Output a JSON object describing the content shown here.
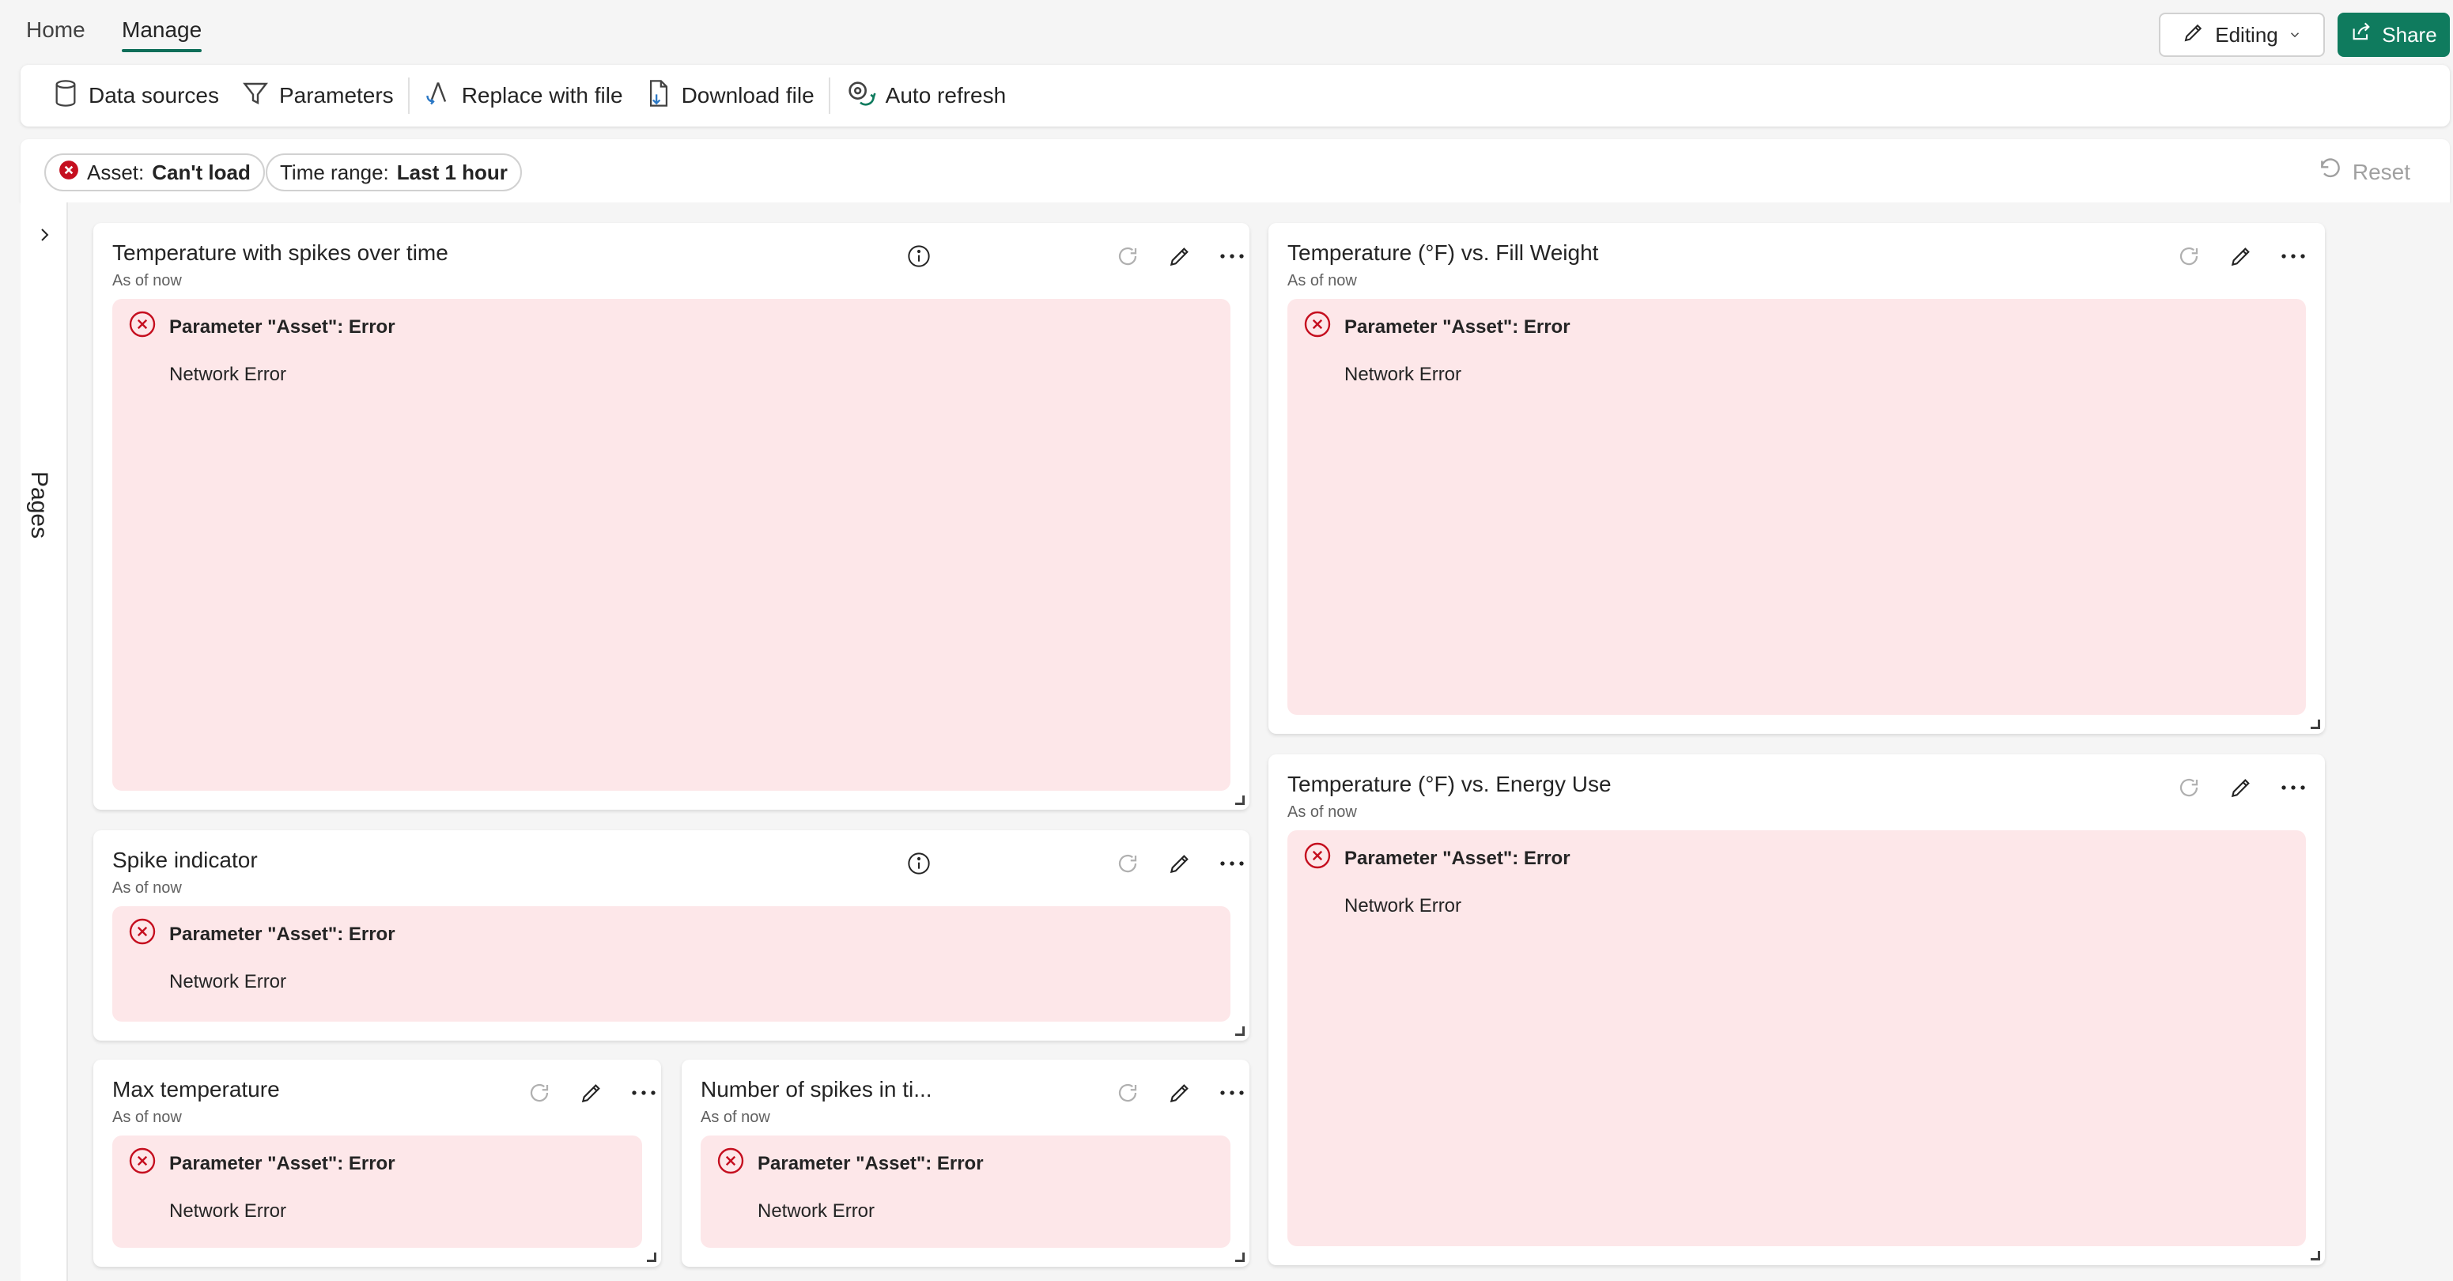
{
  "nav": {
    "tabs": [
      {
        "label": "Home"
      },
      {
        "label": "Manage"
      }
    ],
    "editing_label": "Editing",
    "share_label": "Share"
  },
  "ribbon": {
    "data_sources": "Data sources",
    "parameters": "Parameters",
    "replace_with_file": "Replace with file",
    "download_file": "Download file",
    "auto_refresh": "Auto refresh"
  },
  "filters": {
    "asset_key": "Asset:",
    "asset_value": "Can't load",
    "time_key": "Time range:",
    "time_value": "Last 1 hour",
    "reset_label": "Reset"
  },
  "sidebar": {
    "pages_label": "Pages"
  },
  "tiles": {
    "t1": {
      "title": "Temperature with spikes over time",
      "subtitle": "As of now",
      "error_title": "Parameter \"Asset\": Error",
      "error_message": "Network Error"
    },
    "t2": {
      "title": "Temperature (°F) vs. Fill Weight",
      "subtitle": "As of now",
      "error_title": "Parameter \"Asset\": Error",
      "error_message": "Network Error"
    },
    "t3": {
      "title": "Spike indicator",
      "subtitle": "As of now",
      "error_title": "Parameter \"Asset\": Error",
      "error_message": "Network Error"
    },
    "t4": {
      "title": "Temperature (°F) vs. Energy Use",
      "subtitle": "As of now",
      "error_title": "Parameter \"Asset\": Error",
      "error_message": "Network Error"
    },
    "t5": {
      "title": "Max temperature",
      "subtitle": "As of now",
      "error_title": "Parameter \"Asset\": Error",
      "error_message": "Network Error"
    },
    "t6": {
      "title": "Number of spikes in ti...",
      "subtitle": "As of now",
      "error_title": "Parameter \"Asset\": Error",
      "error_message": "Network Error"
    }
  },
  "colors": {
    "accent": "#0f7b5e",
    "error_bg": "#fde7e9",
    "error_icon": "#c50f1f"
  }
}
